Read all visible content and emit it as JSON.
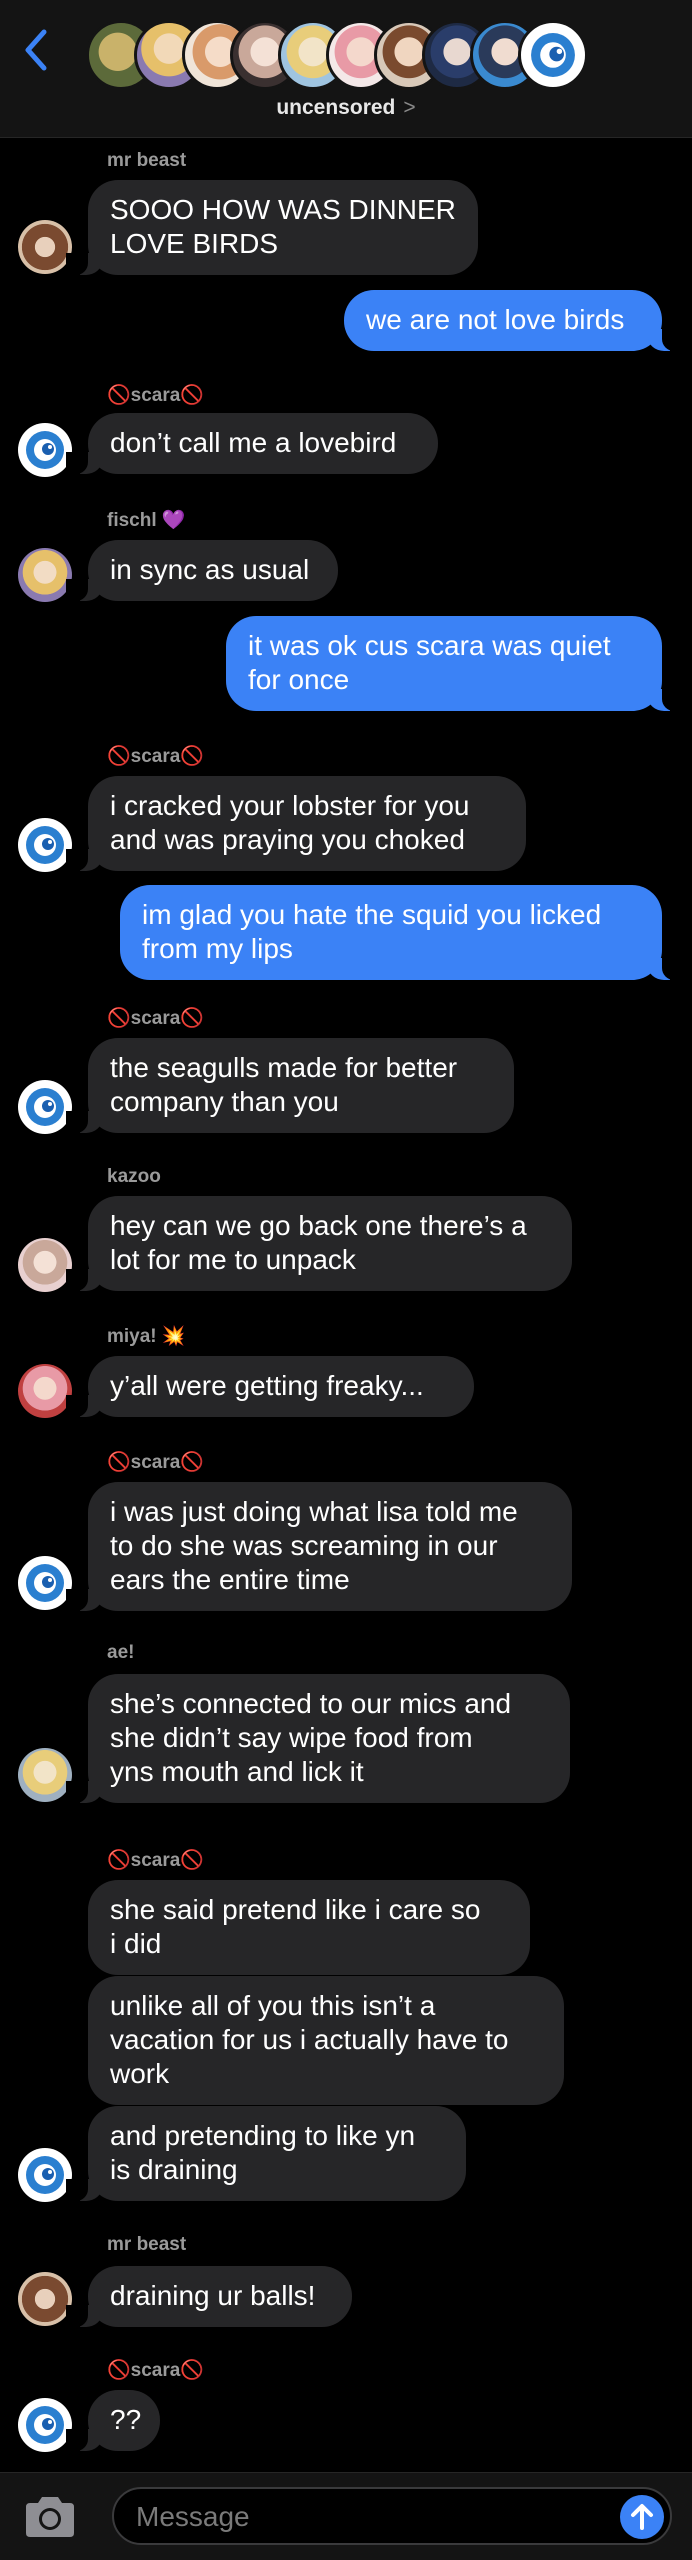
{
  "header": {
    "group_name": "uncensored",
    "avatars": [
      "avatar-1",
      "avatar-2",
      "avatar-3",
      "avatar-4",
      "avatar-5",
      "avatar-6",
      "avatar-7",
      "avatar-8",
      "avatar-9",
      "avatar-10"
    ]
  },
  "messages": [
    {
      "sender": "mr beast",
      "text": "SOOO HOW WAS DINNER\nLOVE BIRDS"
    },
    {
      "text": "we are not love birds"
    },
    {
      "sender": "scara",
      "text": "don’t call me a lovebird"
    },
    {
      "sender": "fischl",
      "sender_emoji": "💜",
      "text": "in sync as usual"
    },
    {
      "text": "it was ok cus scara was quiet\nfor once"
    },
    {
      "sender": "scara",
      "text": "i cracked your lobster for you\nand was praying you choked"
    },
    {
      "text": "im glad you hate the squid you licked\nfrom my lips"
    },
    {
      "sender": "scara",
      "text": "the seagulls made for better\ncompany than you"
    },
    {
      "sender": "kazoo",
      "text": "hey can we go back one there’s a\nlot for me to unpack"
    },
    {
      "sender": "miya!",
      "sender_emoji": "💥",
      "text": "y’all were getting freaky..."
    },
    {
      "sender": "scara",
      "text": "i was just doing what lisa told me\nto do she was screaming in our\nears the entire time"
    },
    {
      "sender": "ae!",
      "text": "she’s connected to our mics and\nshe didn’t say wipe food from\nyns mouth and lick it"
    },
    {
      "sender": "scara",
      "text": "she said pretend like i care so\ni did"
    },
    {
      "text": "unlike all of you this isn’t a\nvacation for us i actually have to\nwork"
    },
    {
      "text": "and pretending to like yn\nis draining"
    },
    {
      "sender": "mr beast",
      "text": "draining ur balls!"
    },
    {
      "sender": "scara",
      "text": "??"
    }
  ],
  "composer": {
    "placeholder": "Message"
  },
  "symbols": {
    "prohibited": "🚫",
    "chevron": ">"
  },
  "colors": {
    "outgoing": "#3b82f6",
    "incoming": "#262628",
    "background": "#000000",
    "accent": "#3b82f6"
  }
}
